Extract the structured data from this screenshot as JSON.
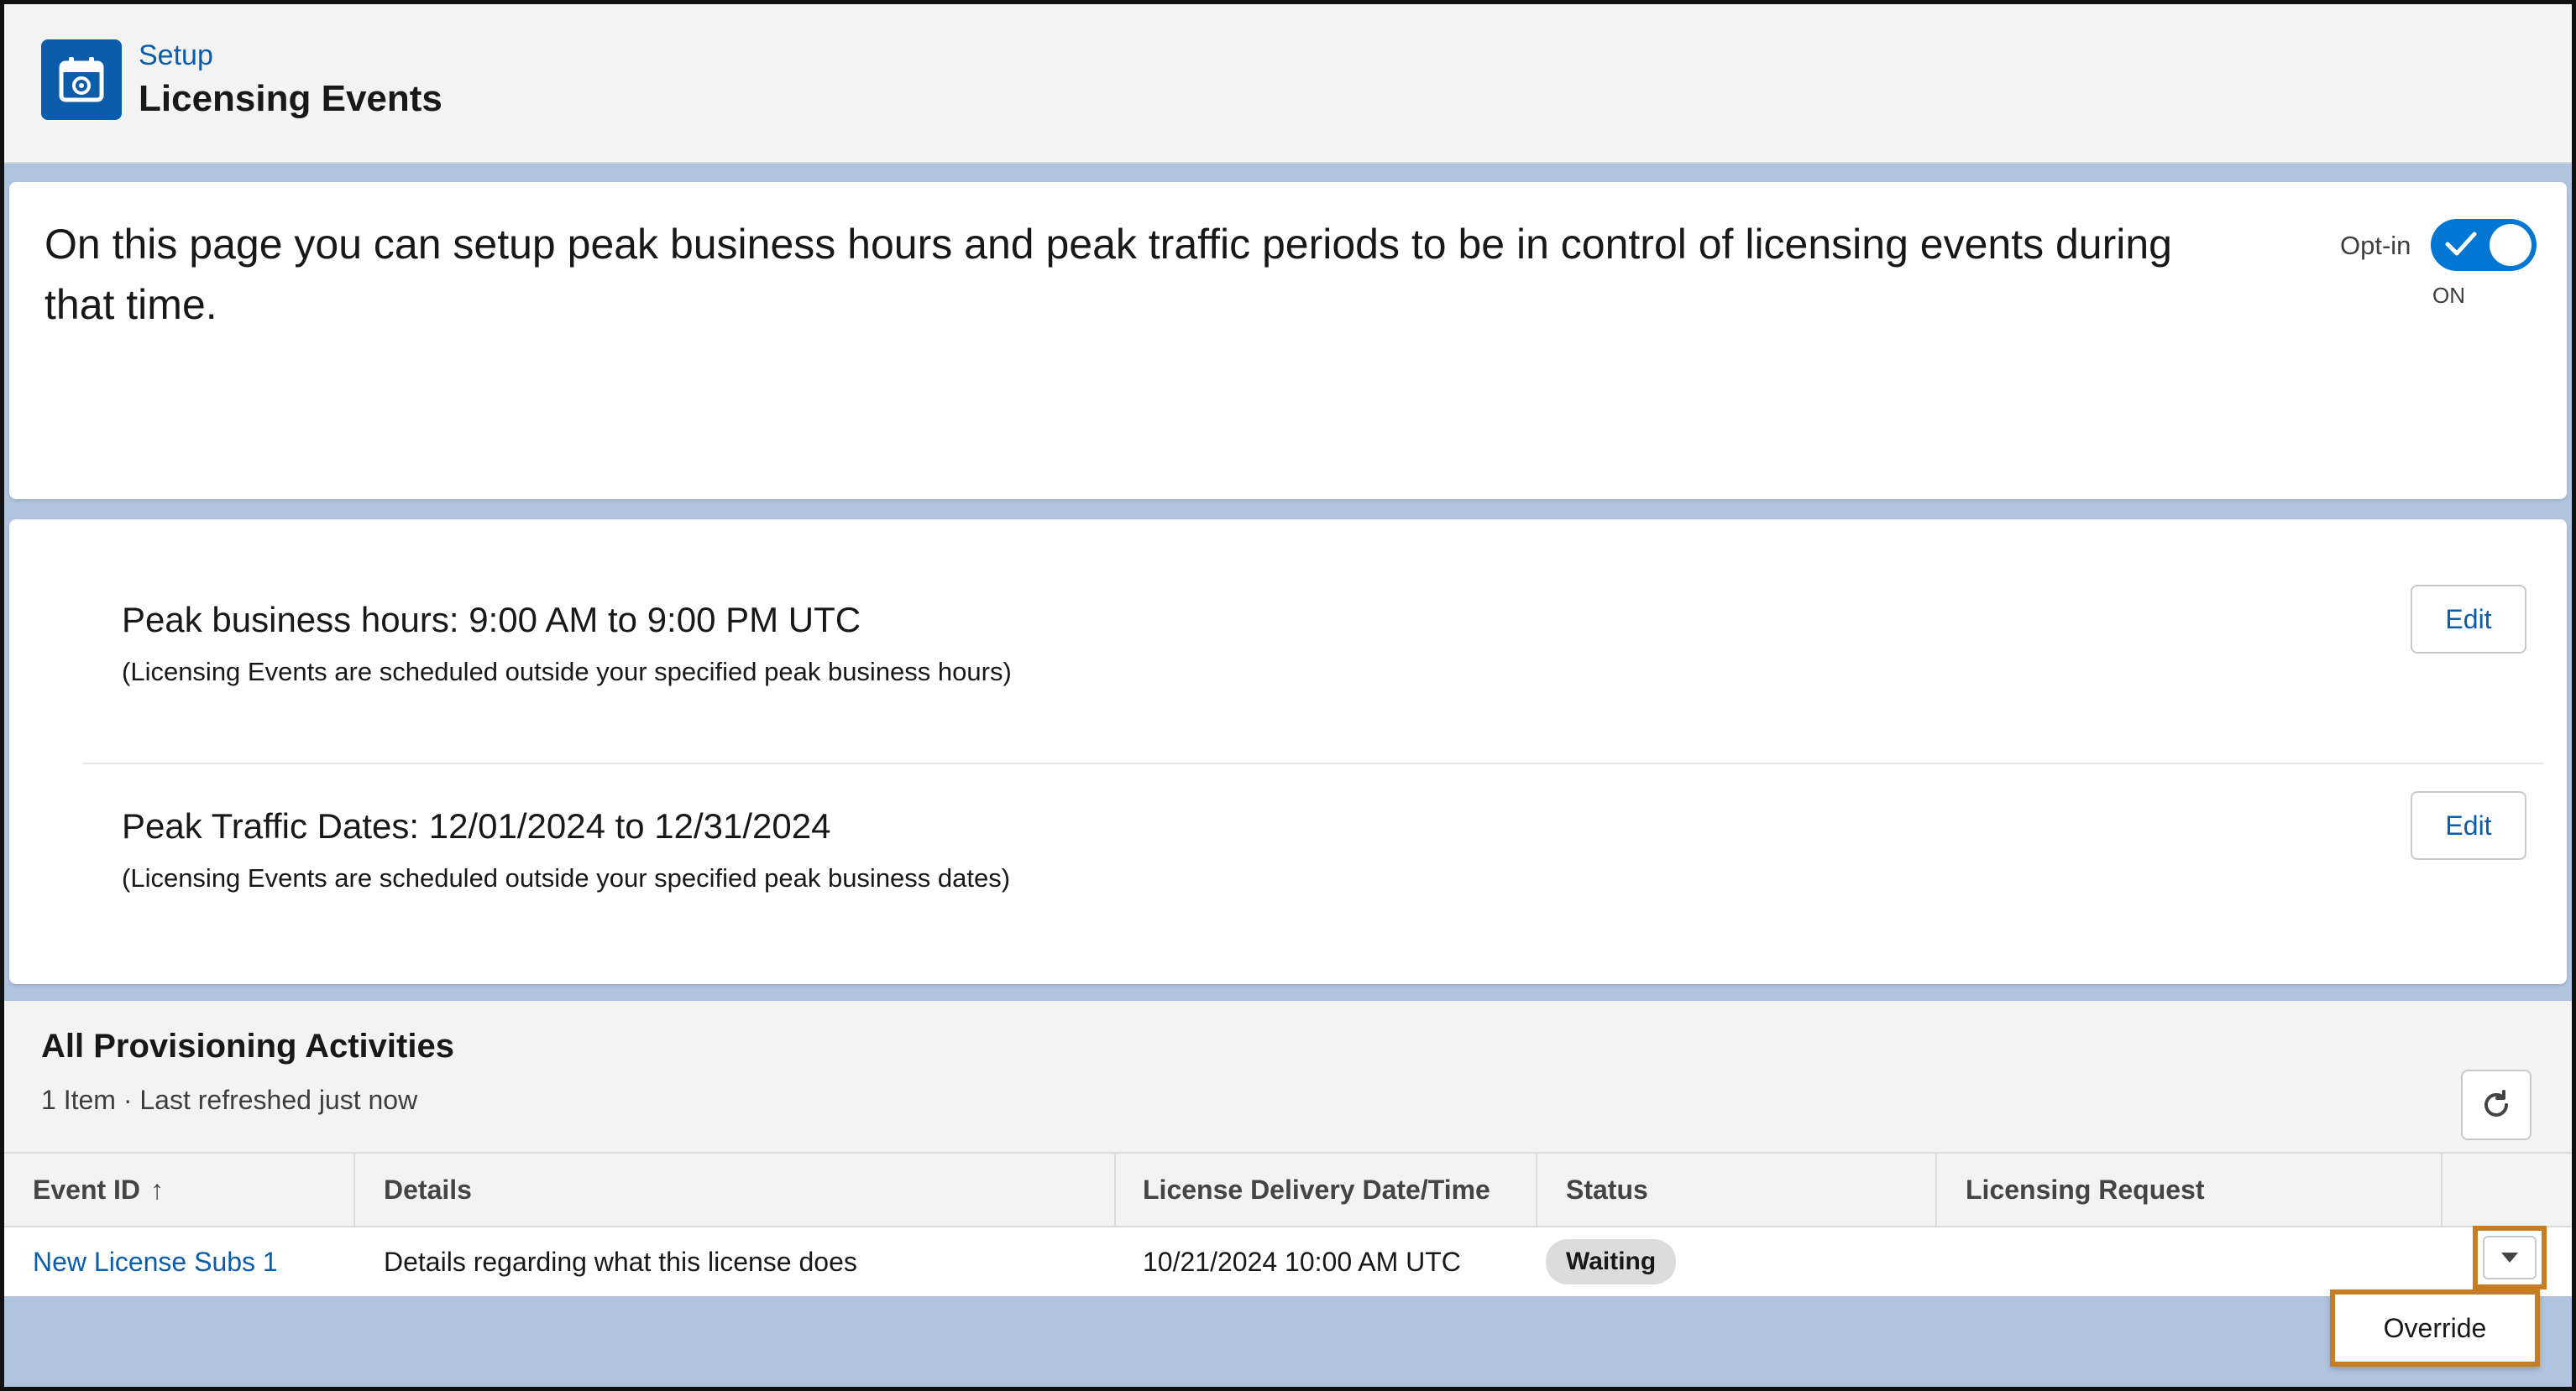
{
  "header": {
    "eyebrow": "Setup",
    "title": "Licensing Events",
    "icon": "calendar-gear-icon"
  },
  "intro": {
    "text": "On this page you can setup peak business hours and peak traffic periods to be in control of licensing events during that time.",
    "optin_label": "Opt-in",
    "toggle_state": "ON",
    "toggle_on": true
  },
  "peak": {
    "hours": {
      "title": "Peak business hours: 9:00 AM to 9:00 PM UTC",
      "subtitle": "(Licensing Events are scheduled outside your specified peak business hours)",
      "edit_label": "Edit"
    },
    "dates": {
      "title": "Peak Traffic Dates: 12/01/2024 to 12/31/2024",
      "subtitle": "(Licensing Events are scheduled outside your specified peak business dates)",
      "edit_label": "Edit"
    }
  },
  "activities": {
    "title": "All Provisioning Activities",
    "meta": "1 Item · Last refreshed just now",
    "columns": [
      "Event ID",
      "Details",
      "License Delivery Date/Time",
      "Status",
      "Licensing Request"
    ],
    "sort_indicator": "↑",
    "rows": [
      {
        "event_id": "New License Subs 1",
        "details": "Details regarding what this license does",
        "delivery": "10/21/2024 10:00 AM UTC",
        "status": "Waiting",
        "licensing_request": ""
      }
    ],
    "row_menu_option": "Override"
  },
  "colors": {
    "brand": "#0b5cab",
    "toggle": "#0176d3",
    "highlight": "#c77d22",
    "backdrop": "#b0c4df"
  }
}
